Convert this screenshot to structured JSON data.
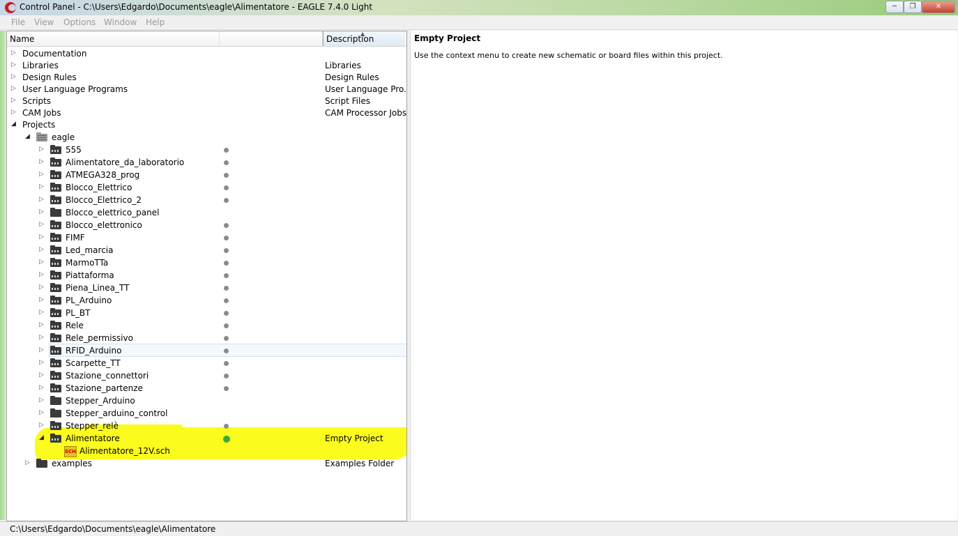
{
  "window": {
    "title": "Control Panel - C:\\Users\\Edgardo\\Documents\\eagle\\Alimentatore - EAGLE 7.4.0 Light",
    "minimize_label": "─",
    "maximize_label": "❐",
    "close_label": "✕"
  },
  "menu": [
    "File",
    "View",
    "Options",
    "Window",
    "Help"
  ],
  "tree": {
    "columns": {
      "name": "Name",
      "description": "Description"
    },
    "top_items": [
      {
        "label": "Documentation",
        "description": ""
      },
      {
        "label": "Libraries",
        "description": "Libraries"
      },
      {
        "label": "Design Rules",
        "description": "Design Rules"
      },
      {
        "label": "User Language Programs",
        "description": "User Language Pro..."
      },
      {
        "label": "Scripts",
        "description": "Script Files"
      },
      {
        "label": "CAM Jobs",
        "description": "CAM Processor Jobs"
      },
      {
        "label": "Projects",
        "description": ""
      }
    ],
    "eagle_folder": "eagle",
    "projects": [
      "555",
      "Alimentatore_da_laboratorio",
      "ATMEGA328_prog",
      "Blocco_Elettrico",
      "Blocco_Elettrico_2",
      "Blocco_elettrico_panel",
      "Blocco_elettronico",
      "FIMF",
      "Led_marcia",
      "MarmoTTa",
      "Piattaforma",
      "Piena_Linea_TT",
      "PL_Arduino",
      "PL_BT",
      "Rele",
      "Rele_permissivo",
      "RFID_Arduino",
      "Scarpette_TT",
      "Stazione_connettori",
      "Stazione_partenze",
      "Stepper_Arduino",
      "Stepper_arduino_control",
      "Stepper_relè"
    ],
    "active_project": {
      "label": "Alimentatore",
      "description": "Empty Project"
    },
    "active_file": {
      "label": "Alimentatore_12V.sch",
      "badge": "SCH"
    },
    "examples": {
      "label": "examples",
      "description": "Examples Folder"
    }
  },
  "detail": {
    "title": "Empty Project",
    "text": "Use the context menu to create new schematic or board files within this project."
  },
  "status": {
    "path": "C:\\Users\\Edgardo\\Documents\\eagle\\Alimentatore"
  },
  "colors": {
    "highlight": "#fbfb1e",
    "active_dot": "#3aa83a",
    "folder": "#3a3a3a"
  }
}
